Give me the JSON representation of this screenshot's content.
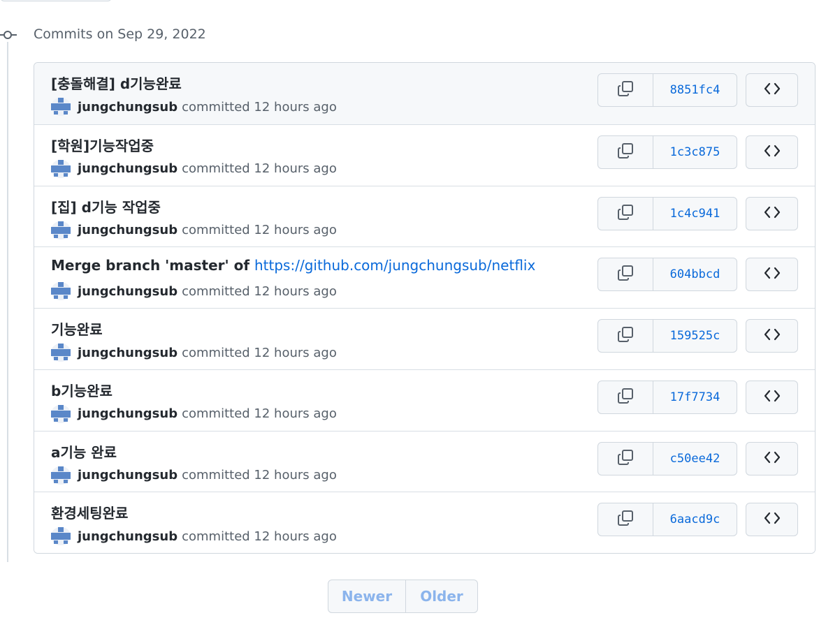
{
  "heading": {
    "date": "Commits on Sep 29, 2022"
  },
  "commits": [
    {
      "title": "[충돌해결] d기능완료",
      "link": "",
      "author": "jungchungsub",
      "action": "committed 12 hours ago",
      "sha": "8851fc4"
    },
    {
      "title": "[학원]기능작업중",
      "link": "",
      "author": "jungchungsub",
      "action": "committed 12 hours ago",
      "sha": "1c3c875"
    },
    {
      "title": "[집] d기능 작업중",
      "link": "",
      "author": "jungchungsub",
      "action": "committed 12 hours ago",
      "sha": "1c4c941"
    },
    {
      "title": "Merge branch 'master' of ",
      "link": "https://github.com/jungchungsub/netflix",
      "author": "jungchungsub",
      "action": "committed 12 hours ago",
      "sha": "604bbcd"
    },
    {
      "title": "기능완료",
      "link": "",
      "author": "jungchungsub",
      "action": "committed 12 hours ago",
      "sha": "159525c"
    },
    {
      "title": "b기능완료",
      "link": "",
      "author": "jungchungsub",
      "action": "committed 12 hours ago",
      "sha": "17f7734"
    },
    {
      "title": "a기능 완료",
      "link": "",
      "author": "jungchungsub",
      "action": "committed 12 hours ago",
      "sha": "c50ee42"
    },
    {
      "title": "환경세팅완료",
      "link": "",
      "author": "jungchungsub",
      "action": "committed 12 hours ago",
      "sha": "6aacd9c"
    }
  ],
  "pagination": {
    "newer": "Newer",
    "older": "Older"
  },
  "icons": {
    "copy": "copy-icon",
    "browse": "code-icon",
    "commit": "git-commit-icon"
  },
  "colors": {
    "link": "#0969da",
    "muted": "#57606a",
    "border": "#d0d7de",
    "disabled_text": "#8bb4ec"
  }
}
